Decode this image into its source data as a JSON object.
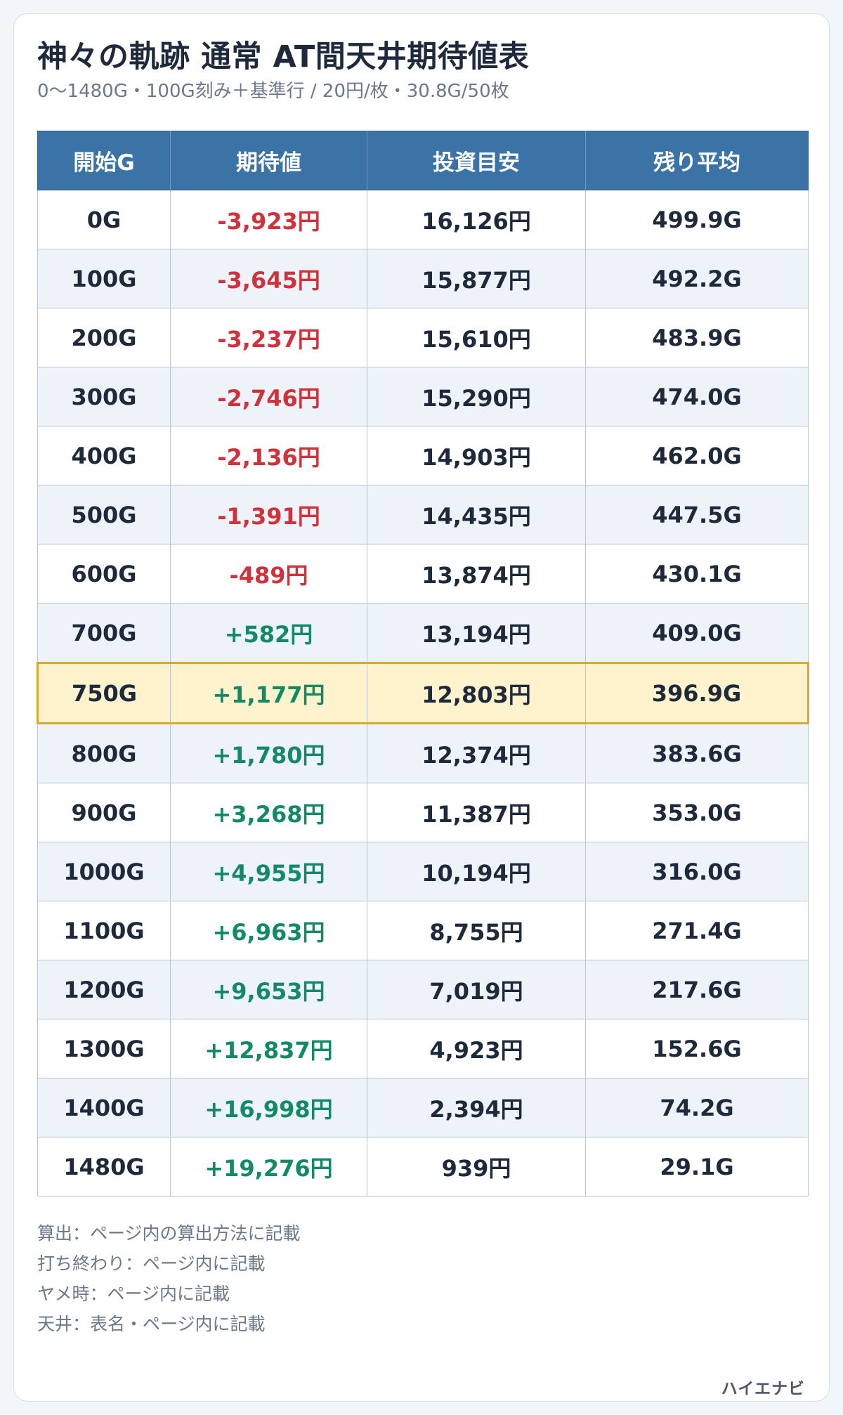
{
  "title": "神々の軌跡 通常 AT間天井期待値表",
  "subtitle": "0〜1480G・100G刻み＋基準行 / 20円/枚・30.8G/50枚",
  "table": {
    "headers": [
      "開始G",
      "期待値",
      "投資目安",
      "残り平均"
    ],
    "rows": [
      {
        "start": "0G",
        "ev": "-3,923円",
        "invest": "16,126円",
        "remain": "499.9G",
        "ev_sign": "neg"
      },
      {
        "start": "100G",
        "ev": "-3,645円",
        "invest": "15,877円",
        "remain": "492.2G",
        "ev_sign": "neg"
      },
      {
        "start": "200G",
        "ev": "-3,237円",
        "invest": "15,610円",
        "remain": "483.9G",
        "ev_sign": "neg"
      },
      {
        "start": "300G",
        "ev": "-2,746円",
        "invest": "15,290円",
        "remain": "474.0G",
        "ev_sign": "neg"
      },
      {
        "start": "400G",
        "ev": "-2,136円",
        "invest": "14,903円",
        "remain": "462.0G",
        "ev_sign": "neg"
      },
      {
        "start": "500G",
        "ev": "-1,391円",
        "invest": "14,435円",
        "remain": "447.5G",
        "ev_sign": "neg"
      },
      {
        "start": "600G",
        "ev": "-489円",
        "invest": "13,874円",
        "remain": "430.1G",
        "ev_sign": "neg"
      },
      {
        "start": "700G",
        "ev": "+582円",
        "invest": "13,194円",
        "remain": "409.0G",
        "ev_sign": "pos"
      },
      {
        "start": "750G",
        "ev": "+1,177円",
        "invest": "12,803円",
        "remain": "396.9G",
        "ev_sign": "pos",
        "highlight": true
      },
      {
        "start": "800G",
        "ev": "+1,780円",
        "invest": "12,374円",
        "remain": "383.6G",
        "ev_sign": "pos"
      },
      {
        "start": "900G",
        "ev": "+3,268円",
        "invest": "11,387円",
        "remain": "353.0G",
        "ev_sign": "pos"
      },
      {
        "start": "1000G",
        "ev": "+4,955円",
        "invest": "10,194円",
        "remain": "316.0G",
        "ev_sign": "pos"
      },
      {
        "start": "1100G",
        "ev": "+6,963円",
        "invest": "8,755円",
        "remain": "271.4G",
        "ev_sign": "pos"
      },
      {
        "start": "1200G",
        "ev": "+9,653円",
        "invest": "7,019円",
        "remain": "217.6G",
        "ev_sign": "pos"
      },
      {
        "start": "1300G",
        "ev": "+12,837円",
        "invest": "4,923円",
        "remain": "152.6G",
        "ev_sign": "pos"
      },
      {
        "start": "1400G",
        "ev": "+16,998円",
        "invest": "2,394円",
        "remain": "74.2G",
        "ev_sign": "pos"
      },
      {
        "start": "1480G",
        "ev": "+19,276円",
        "invest": "939円",
        "remain": "29.1G",
        "ev_sign": "pos"
      }
    ]
  },
  "notes": [
    "算出：ページ内の算出方法に記載",
    "打ち終わり：ページ内に記載",
    "ヤメ時：ページ内に記載",
    "天井：表名・ページ内に記載"
  ],
  "brand": "ハイエナビ",
  "colors": {
    "header_bg": "#3b73a7",
    "negative": "#d0313a",
    "positive": "#138a66",
    "highlight_bg": "#fff3cd",
    "highlight_border": "#d9a82e",
    "alt_row_bg": "#eef3fa"
  }
}
